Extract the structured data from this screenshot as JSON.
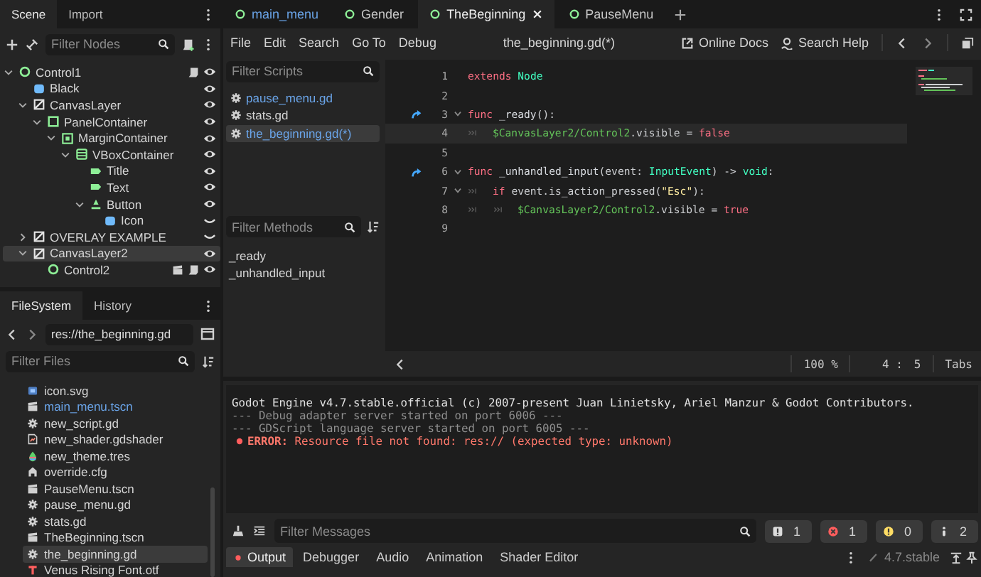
{
  "scene_dock": {
    "tabs": [
      {
        "label": "Scene",
        "selected": true
      },
      {
        "label": "Import",
        "selected": false
      }
    ],
    "filter": {
      "placeholder": "Filter Nodes"
    },
    "tree": [
      {
        "label": "Control1",
        "kind": "control",
        "expanded": true,
        "visible": true,
        "script": true,
        "selected": false,
        "children": [
          {
            "label": "Black",
            "kind": "texture-rect",
            "visible": true,
            "selected": false
          },
          {
            "label": "CanvasLayer",
            "kind": "canvas-layer",
            "expanded": true,
            "visible": true,
            "selected": false,
            "children": [
              {
                "label": "PanelContainer",
                "kind": "panel",
                "expanded": true,
                "visible": true,
                "selected": false,
                "children": [
                  {
                    "label": "MarginContainer",
                    "kind": "margin",
                    "expanded": true,
                    "visible": true,
                    "selected": false,
                    "children": [
                      {
                        "label": "VBoxContainer",
                        "kind": "vbox",
                        "expanded": true,
                        "visible": true,
                        "selected": false,
                        "children": [
                          {
                            "label": "Title",
                            "kind": "label",
                            "visible": true,
                            "selected": false
                          },
                          {
                            "label": "Text",
                            "kind": "label",
                            "visible": true,
                            "selected": false
                          },
                          {
                            "label": "Button",
                            "kind": "button",
                            "expanded": true,
                            "visible": true,
                            "selected": false,
                            "children": [
                              {
                                "label": "Icon",
                                "kind": "texture-rect",
                                "visible": false,
                                "selected": false
                              }
                            ]
                          }
                        ]
                      }
                    ]
                  }
                ]
              }
            ]
          },
          {
            "label": "OVERLAY EXAMPLE",
            "kind": "canvas-layer",
            "expanded": false,
            "visible": false,
            "selected": false
          },
          {
            "label": "CanvasLayer2",
            "kind": "canvas-layer",
            "expanded": true,
            "visible": true,
            "selected": true,
            "children": [
              {
                "label": "Control2",
                "kind": "control",
                "visible": true,
                "scene": true,
                "script": true,
                "selected": false
              }
            ]
          }
        ]
      }
    ]
  },
  "filesystem_dock": {
    "tabs": [
      {
        "label": "FileSystem",
        "selected": true
      },
      {
        "label": "History",
        "selected": false
      }
    ],
    "path": "res://the_beginning.gd",
    "filter": {
      "placeholder": "Filter Files"
    },
    "files": [
      {
        "name": "icon.svg",
        "kind": "texture",
        "highlighted": false,
        "selected": false
      },
      {
        "name": "main_menu.tscn",
        "kind": "scene",
        "highlighted": true,
        "selected": false
      },
      {
        "name": "new_script.gd",
        "kind": "script",
        "highlighted": false,
        "selected": false
      },
      {
        "name": "new_shader.gdshader",
        "kind": "shader",
        "highlighted": false,
        "selected": false
      },
      {
        "name": "new_theme.tres",
        "kind": "theme",
        "highlighted": false,
        "selected": false
      },
      {
        "name": "override.cfg",
        "kind": "config",
        "highlighted": false,
        "selected": false
      },
      {
        "name": "PauseMenu.tscn",
        "kind": "scene",
        "highlighted": false,
        "selected": false
      },
      {
        "name": "pause_menu.gd",
        "kind": "script",
        "highlighted": false,
        "selected": false
      },
      {
        "name": "stats.gd",
        "kind": "script",
        "highlighted": false,
        "selected": false
      },
      {
        "name": "TheBeginning.tscn",
        "kind": "scene",
        "highlighted": false,
        "selected": false
      },
      {
        "name": "the_beginning.gd",
        "kind": "script",
        "highlighted": false,
        "selected": true
      },
      {
        "name": "Venus Rising Font.otf",
        "kind": "font",
        "highlighted": false,
        "selected": false
      }
    ]
  },
  "scene_tabs": [
    {
      "label": "main_menu",
      "highlighted": true,
      "selected": false
    },
    {
      "label": "Gender",
      "highlighted": false,
      "selected": false
    },
    {
      "label": "TheBeginning",
      "highlighted": false,
      "selected": true
    },
    {
      "label": "PauseMenu",
      "highlighted": false,
      "selected": false
    }
  ],
  "script_menu": [
    "File",
    "Edit",
    "Search",
    "Go To",
    "Debug"
  ],
  "script_title": "the_beginning.gd(*)",
  "help_links": [
    {
      "kind": "docs",
      "label": "Online Docs"
    },
    {
      "kind": "help",
      "label": "Search Help"
    }
  ],
  "script_list": {
    "filter": {
      "placeholder": "Filter Scripts"
    },
    "items": [
      {
        "name": "pause_menu.gd",
        "highlighted": true,
        "selected": false
      },
      {
        "name": "stats.gd",
        "highlighted": false,
        "selected": false
      },
      {
        "name": "the_beginning.gd(*)",
        "highlighted": true,
        "selected": true
      }
    ]
  },
  "method_list": {
    "filter": {
      "placeholder": "Filter Methods"
    },
    "items": [
      "_ready",
      "_unhandled_input"
    ]
  },
  "code": [
    {
      "number": "1",
      "tokens": [
        {
          "kind": "keyword",
          "text": "extends "
        },
        {
          "kind": "type",
          "text": "Node"
        }
      ]
    },
    {
      "number": "2"
    },
    {
      "number": "3",
      "connected": true,
      "foldable": true,
      "tokens": [
        {
          "kind": "keyword",
          "text": "func "
        },
        {
          "kind": "function",
          "text": "_ready"
        },
        {
          "kind": "plain",
          "text": "():"
        }
      ]
    },
    {
      "number": "4",
      "current": true,
      "tokens": [
        {
          "kind": "tab"
        },
        {
          "kind": "node-path",
          "text": "$CanvasLayer2/Control2"
        },
        {
          "kind": "plain",
          "text": ".visible = "
        },
        {
          "kind": "keyword",
          "text": "false"
        }
      ]
    },
    {
      "number": "5"
    },
    {
      "number": "6",
      "connected": true,
      "foldable": true,
      "tokens": [
        {
          "kind": "keyword",
          "text": "func "
        },
        {
          "kind": "function",
          "text": "_unhandled_input"
        },
        {
          "kind": "plain",
          "text": "(event: "
        },
        {
          "kind": "type",
          "text": "InputEvent"
        },
        {
          "kind": "plain",
          "text": ") -> "
        },
        {
          "kind": "type",
          "text": "void"
        },
        {
          "kind": "plain",
          "text": ":"
        }
      ]
    },
    {
      "number": "7",
      "foldable": true,
      "tokens": [
        {
          "kind": "tab"
        },
        {
          "kind": "keyword",
          "text": "if "
        },
        {
          "kind": "plain",
          "text": "event.is_action_pressed("
        },
        {
          "kind": "string",
          "text": "\"Esc\""
        },
        {
          "kind": "plain",
          "text": "):"
        }
      ]
    },
    {
      "number": "8",
      "tokens": [
        {
          "kind": "tab"
        },
        {
          "kind": "tab"
        },
        {
          "kind": "node-path",
          "text": "$CanvasLayer2/Control2"
        },
        {
          "kind": "plain",
          "text": ".visible = "
        },
        {
          "kind": "keyword",
          "text": "true"
        }
      ]
    },
    {
      "number": "9"
    }
  ],
  "code_status": {
    "zoom": "100 %",
    "line": "4 :",
    "column": "5",
    "indentation": "Tabs"
  },
  "output": [
    {
      "kind": "normal",
      "text": "Godot Engine v4.7.stable.official (c) 2007-present Juan Linietsky, Ariel Manzur & Godot Contributors."
    },
    {
      "kind": "muted",
      "text": "--- Debug adapter server started on port 6006 ---"
    },
    {
      "kind": "muted",
      "text": "--- GDScript language server started on port 6005 ---"
    },
    {
      "kind": "error",
      "text": "**ERROR:** Resource file not found: res:// (expected type: unknown)"
    }
  ],
  "message_filter": {
    "placeholder": "Filter Messages"
  },
  "message_counts": [
    {
      "kind": "message",
      "count": "1"
    },
    {
      "kind": "error",
      "count": "1"
    },
    {
      "kind": "warning",
      "count": "0"
    },
    {
      "kind": "editor",
      "count": "2"
    }
  ],
  "bottom_tabs": [
    {
      "label": "Output",
      "selected": true,
      "alert": true
    },
    {
      "label": "Debugger",
      "selected": false,
      "alert": false
    },
    {
      "label": "Audio",
      "selected": false,
      "alert": false
    },
    {
      "label": "Animation",
      "selected": false,
      "alert": false
    },
    {
      "label": "Shader Editor",
      "selected": false,
      "alert": false
    }
  ],
  "version": "4.7.stable"
}
